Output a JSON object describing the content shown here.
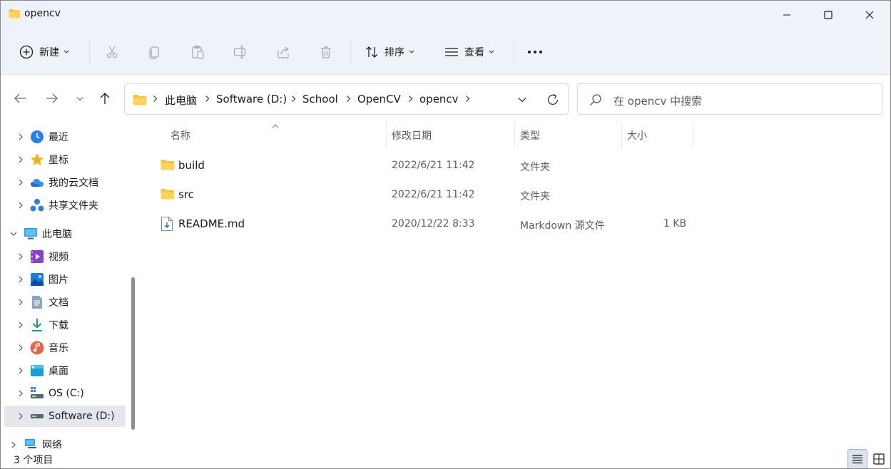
{
  "window": {
    "title": "opencv",
    "minimize_icon": "minimize-icon",
    "maximize_icon": "maximize-icon",
    "close_icon": "close-icon"
  },
  "toolbar": {
    "new_label": "新建",
    "sort_label": "排序",
    "view_label": "查看",
    "more_icon": "more-icon",
    "icons": [
      "cut-icon",
      "copy-icon",
      "paste-icon",
      "rename-icon",
      "share-icon",
      "delete-icon"
    ]
  },
  "address": {
    "crumbs": [
      "此电脑",
      "Software (D:)",
      "School",
      "OpenCV",
      "opencv"
    ],
    "search_placeholder": "在 opencv 中搜索"
  },
  "nav_pane": {
    "items": [
      {
        "label": "最近",
        "icon": "clock-icon"
      },
      {
        "label": "星标",
        "icon": "star-icon"
      },
      {
        "label": "我的云文档",
        "icon": "cloud-icon"
      },
      {
        "label": "共享文件夹",
        "icon": "share-nodes-icon"
      },
      {
        "label": "此电脑",
        "icon": "monitor-icon"
      },
      {
        "label": "视频",
        "icon": "video-icon"
      },
      {
        "label": "图片",
        "icon": "image-icon"
      },
      {
        "label": "文档",
        "icon": "document-icon"
      },
      {
        "label": "下载",
        "icon": "download-icon"
      },
      {
        "label": "音乐",
        "icon": "music-icon"
      },
      {
        "label": "桌面",
        "icon": "desktop-icon"
      },
      {
        "label": "OS (C:)",
        "icon": "drive-icon"
      },
      {
        "label": "Software (D:)",
        "icon": "drive-icon"
      },
      {
        "label": "网络",
        "icon": "network-icon"
      }
    ],
    "selected": "Software (D:)"
  },
  "file_list": {
    "columns": [
      "名称",
      "修改日期",
      "类型",
      "大小"
    ],
    "rows": [
      {
        "name": "build",
        "date": "2022/6/21 11:42",
        "type": "文件夹",
        "size": "",
        "icon": "folder-icon"
      },
      {
        "name": "src",
        "date": "2022/6/21 11:42",
        "type": "文件夹",
        "size": "",
        "icon": "folder-icon"
      },
      {
        "name": "README.md",
        "date": "2020/12/22 8:33",
        "type": "Markdown 源文件",
        "size": "1 KB",
        "icon": "markdown-file-icon"
      }
    ]
  },
  "status": {
    "item_count": "3 个项目"
  },
  "colors": {
    "chrome_bg": "#eef3f9",
    "folder": "#f7c240",
    "accent": "#0067c0"
  }
}
